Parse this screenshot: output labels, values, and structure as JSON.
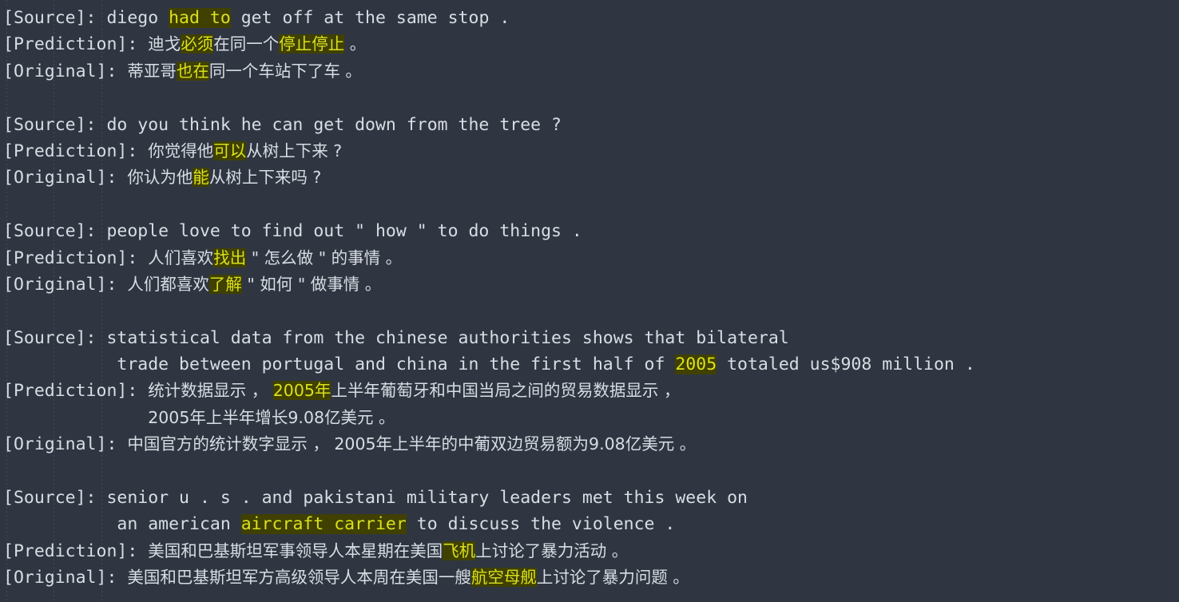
{
  "terminal": {
    "background_color": "#2f3642",
    "text_color": "#d9dde3",
    "highlight_background": "#404000",
    "highlight_text_color": "#d9e01e",
    "label_source": "[Source]: ",
    "label_prediction": "[Prediction]: ",
    "label_original": "[Original]: ",
    "continuation_indent": "              "
  },
  "examples": [
    {
      "id": "example-1",
      "source": [
        [
          {
            "t": "[Source]: diego ",
            "h": false
          },
          {
            "t": "had to",
            "h": true
          },
          {
            "t": " get off at the same stop .",
            "h": false
          }
        ]
      ],
      "prediction": [
        [
          {
            "t": "[Prediction]: ",
            "h": false,
            "cjk": false
          },
          {
            "t": "迪戈",
            "h": false,
            "cjk": true
          },
          {
            "t": "必须",
            "h": true,
            "cjk": true
          },
          {
            "t": "在同一个",
            "h": false,
            "cjk": true
          },
          {
            "t": "停止停止",
            "h": true,
            "cjk": true
          },
          {
            "t": " 。",
            "h": false,
            "cjk": true
          }
        ]
      ],
      "original": [
        [
          {
            "t": "[Original]: ",
            "h": false,
            "cjk": false
          },
          {
            "t": "蒂亚哥",
            "h": false,
            "cjk": true
          },
          {
            "t": "也在",
            "h": true,
            "cjk": true
          },
          {
            "t": "同一个车站下了车 。",
            "h": false,
            "cjk": true
          }
        ]
      ]
    },
    {
      "id": "example-2",
      "source": [
        [
          {
            "t": "[Source]: do you think he can get down from the tree ?",
            "h": false
          }
        ]
      ],
      "prediction": [
        [
          {
            "t": "[Prediction]: ",
            "h": false,
            "cjk": false
          },
          {
            "t": "你觉得他",
            "h": false,
            "cjk": true
          },
          {
            "t": "可以",
            "h": true,
            "cjk": true
          },
          {
            "t": "从树上下来 ?",
            "h": false,
            "cjk": true
          }
        ]
      ],
      "original": [
        [
          {
            "t": "[Original]: ",
            "h": false,
            "cjk": false
          },
          {
            "t": "你认为他",
            "h": false,
            "cjk": true
          },
          {
            "t": "能",
            "h": true,
            "cjk": true
          },
          {
            "t": "从树上下来吗 ?",
            "h": false,
            "cjk": true
          }
        ]
      ]
    },
    {
      "id": "example-3",
      "source": [
        [
          {
            "t": "[Source]: people love to find out \" how \" to do things .",
            "h": false
          }
        ]
      ],
      "prediction": [
        [
          {
            "t": "[Prediction]: ",
            "h": false,
            "cjk": false
          },
          {
            "t": "人们喜欢",
            "h": false,
            "cjk": true
          },
          {
            "t": "找出",
            "h": true,
            "cjk": true
          },
          {
            "t": " \" 怎么做 \" 的事情 。",
            "h": false,
            "cjk": true
          }
        ]
      ],
      "original": [
        [
          {
            "t": "[Original]: ",
            "h": false,
            "cjk": false
          },
          {
            "t": "人们都喜欢",
            "h": false,
            "cjk": true
          },
          {
            "t": "了解",
            "h": true,
            "cjk": true
          },
          {
            "t": " \" 如何 \" 做事情 。",
            "h": false,
            "cjk": true
          }
        ]
      ]
    },
    {
      "id": "example-4",
      "source": [
        [
          {
            "t": "[Source]: statistical data from the chinese authorities shows that bilateral",
            "h": false
          }
        ],
        [
          {
            "t": "           trade between portugal and china in the first half of ",
            "h": false
          },
          {
            "t": "2005",
            "h": true
          },
          {
            "t": " totaled us$908 million .",
            "h": false
          }
        ]
      ],
      "prediction": [
        [
          {
            "t": "[Prediction]: ",
            "h": false,
            "cjk": false
          },
          {
            "t": "统计数据显示 ， ",
            "h": false,
            "cjk": true
          },
          {
            "t": "2005年",
            "h": true,
            "cjk": true
          },
          {
            "t": "上半年葡萄牙和中国当局之间的贸易数据显示 ，",
            "h": false,
            "cjk": true
          }
        ],
        [
          {
            "t": "              ",
            "h": false,
            "cjk": false
          },
          {
            "t": "2005年上半年增长9.08亿美元 。",
            "h": false,
            "cjk": true
          }
        ]
      ],
      "original": [
        [
          {
            "t": "[Original]: ",
            "h": false,
            "cjk": false
          },
          {
            "t": "中国官方的统计数字显示 ， 2005年上半年的中葡双边贸易额为9.08亿美元 。",
            "h": false,
            "cjk": true
          }
        ]
      ]
    },
    {
      "id": "example-5",
      "source": [
        [
          {
            "t": "[Source]: senior u . s . and pakistani military leaders met this week on",
            "h": false
          }
        ],
        [
          {
            "t": "           an american ",
            "h": false
          },
          {
            "t": "aircraft carrier",
            "h": true
          },
          {
            "t": " to discuss the violence .",
            "h": false
          }
        ]
      ],
      "prediction": [
        [
          {
            "t": "[Prediction]: ",
            "h": false,
            "cjk": false
          },
          {
            "t": "美国和巴基斯坦军事领导人本星期在美国",
            "h": false,
            "cjk": true
          },
          {
            "t": "飞机",
            "h": true,
            "cjk": true
          },
          {
            "t": "上讨论了暴力活动 。",
            "h": false,
            "cjk": true
          }
        ]
      ],
      "original": [
        [
          {
            "t": "[Original]: ",
            "h": false,
            "cjk": false
          },
          {
            "t": "美国和巴基斯坦军方高级领导人本周在美国一艘",
            "h": false,
            "cjk": true
          },
          {
            "t": "航空母舰",
            "h": true,
            "cjk": true
          },
          {
            "t": "上讨论了暴力问题 。",
            "h": false,
            "cjk": true
          }
        ]
      ]
    }
  ],
  "guide_columns": [
    8,
    67,
    127
  ]
}
